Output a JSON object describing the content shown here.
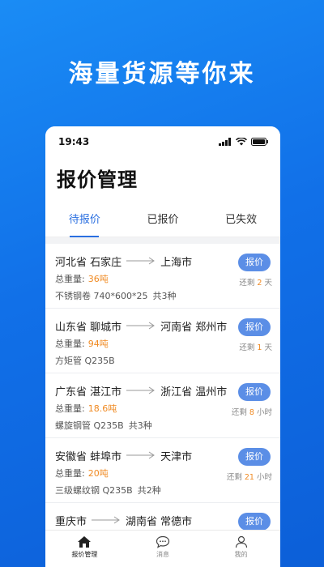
{
  "banner": {
    "title": "海量货源等你来"
  },
  "status_bar": {
    "time": "19:43"
  },
  "page": {
    "title": "报价管理"
  },
  "tabs": [
    {
      "label": "待报价",
      "active": true
    },
    {
      "label": "已报价",
      "active": false
    },
    {
      "label": "已失效",
      "active": false
    }
  ],
  "cards": [
    {
      "origin": "河北省 石家庄",
      "destination": "上海市",
      "weight_label": "总重量:",
      "weight": "36吨",
      "spec": "不锈钢卷 740*600*25",
      "count": "共3种",
      "button": "报价",
      "remain_prefix": "还剩",
      "remain_num": "2",
      "remain_unit": "天"
    },
    {
      "origin": "山东省 聊城市",
      "destination": "河南省 郑州市",
      "weight_label": "总重量:",
      "weight": "94吨",
      "spec": "方矩管 Q235B",
      "count": "",
      "button": "报价",
      "remain_prefix": "还剩",
      "remain_num": "1",
      "remain_unit": "天"
    },
    {
      "origin": "广东省 湛江市",
      "destination": "浙江省 温州市",
      "weight_label": "总重量:",
      "weight": "18.6吨",
      "spec": "螺旋钢管 Q235B",
      "count": "共3种",
      "button": "报价",
      "remain_prefix": "还剩",
      "remain_num": "8",
      "remain_unit": "小时"
    },
    {
      "origin": "安徽省 蚌埠市",
      "destination": "天津市",
      "weight_label": "总重量:",
      "weight": "20吨",
      "spec": "三级螺纹钢 Q235B",
      "count": "共2种",
      "button": "报价",
      "remain_prefix": "还剩",
      "remain_num": "21",
      "remain_unit": "小时"
    },
    {
      "origin": "重庆市",
      "destination": "湖南省 常德市",
      "weight_label": "",
      "weight": "",
      "spec": "",
      "count": "",
      "button": "报价",
      "remain_prefix": "",
      "remain_num": "",
      "remain_unit": ""
    }
  ],
  "tabbar": [
    {
      "label": "报价管理",
      "icon": "home-icon",
      "active": true
    },
    {
      "label": "消息",
      "icon": "chat-bubble-icon",
      "active": false
    },
    {
      "label": "我的",
      "icon": "user-icon",
      "active": false
    }
  ],
  "colors": {
    "brand_blue": "#1a7df0",
    "accent_orange": "#f08a22",
    "button_blue": "#5b8ee6"
  }
}
